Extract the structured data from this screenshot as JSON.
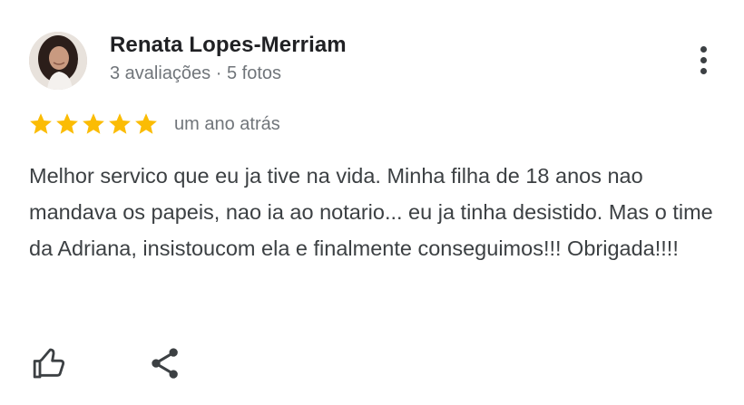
{
  "review": {
    "author": {
      "name": "Renata Lopes-Merriam",
      "meta": "3 avaliações · 5 fotos"
    },
    "rating": {
      "stars": 5,
      "max_stars": 5,
      "star_color": "#fbbc04"
    },
    "time_ago": "um ano atrás",
    "text": "Melhor servico que eu ja tive na vida. Minha filha de 18 anos nao mandava os papeis, nao ia ao notario... eu ja tinha desistido. Mas o time da Adriana, insistoucom ela e finalmente conseguimos!!! Obrigada!!!!"
  },
  "actions": {
    "like_icon": "thumbs-up-outline",
    "share_icon": "share"
  },
  "menu": {
    "icon": "more-vertical"
  },
  "colors": {
    "name": "#202124",
    "secondary": "#70757a",
    "body": "#3c4043",
    "icon": "#3c4043"
  }
}
